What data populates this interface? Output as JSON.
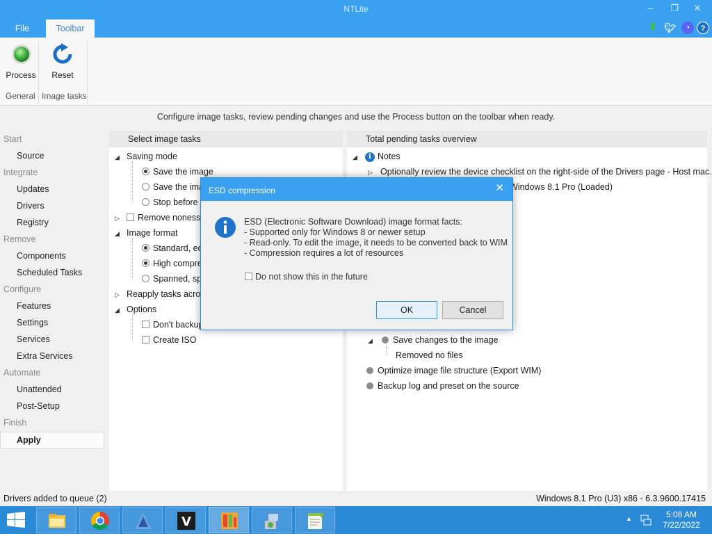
{
  "window": {
    "title": "NTLite",
    "minimize": "–",
    "restore": "❐",
    "close": "✕"
  },
  "menu": {
    "file": "File",
    "toolbar": "Toolbar"
  },
  "top_icons": [
    "update-arrow-icon",
    "twitter-icon",
    "discord-icon",
    "help-icon"
  ],
  "ribbon": {
    "process": "Process",
    "reset": "Reset",
    "group_general": "General",
    "group_image_tasks": "Image tasks"
  },
  "info": "Configure image tasks, review pending changes and use the Process button on the toolbar when ready.",
  "sidebar": {
    "start": "Start",
    "source": "Source",
    "integrate": "Integrate",
    "updates": "Updates",
    "drivers": "Drivers",
    "registry": "Registry",
    "remove": "Remove",
    "components": "Components",
    "scheduled_tasks": "Scheduled Tasks",
    "configure": "Configure",
    "features": "Features",
    "settings": "Settings",
    "services": "Services",
    "extra_services": "Extra Services",
    "automate": "Automate",
    "unattended": "Unattended",
    "post_setup": "Post-Setup",
    "finish": "Finish",
    "apply": "Apply"
  },
  "left_panel": {
    "header": "Select image tasks",
    "saving_mode": "Saving mode",
    "save_image": "Save the image",
    "save_the_ima": "Save the ima",
    "stop_before": "Stop before s",
    "remove_nonesse": "Remove nonesse",
    "image_format": "Image format",
    "standard": "Standard, ed",
    "high_compre": "High compre",
    "spanned": "Spanned, spl",
    "reapply": "Reapply tasks across",
    "options": "Options",
    "dont_backup": "Don't backup",
    "create_iso": "Create ISO"
  },
  "right_panel": {
    "header": "Total pending tasks overview",
    "notes": "Notes",
    "note1": "Optionally review the device checklist on the right-side of the Drivers page - Host mac...",
    "windows_loaded": "Windows 8.1 Pro  (Loaded)",
    "save_changes": "Save changes to the image",
    "removed_no_files": "Removed no files",
    "optimize": "Optimize image file structure (Export WIM)",
    "backup_log": "Backup log and preset on the source"
  },
  "status": {
    "left": "Drivers added to queue (2)",
    "right": "Windows 8.1 Pro (U3) x86 - 6.3.9600.17415"
  },
  "dialog": {
    "title": "ESD compression",
    "close": "✕",
    "heading": "ESD (Electronic Software Download) image format facts:",
    "fact1": " - Supported only for Windows 8 or newer setup",
    "fact2": " - Read-only. To edit the image, it needs to be converted back to WIM",
    "fact3": " - Compression requires a lot of resources",
    "checkbox": "Do not show this in the future",
    "ok": "OK",
    "cancel": "Cancel"
  },
  "taskbar": {
    "apps": [
      "file-explorer-icon",
      "chrome-icon",
      "app-a-icon",
      "app-v-icon",
      "ntlite-icon",
      "installer-icon",
      "notepad-plus-icon"
    ],
    "time": "5:08 AM",
    "date": "7/22/2022"
  },
  "colors": {
    "accent": "#3aa0f0",
    "taskbar": "#2b8ad7"
  }
}
